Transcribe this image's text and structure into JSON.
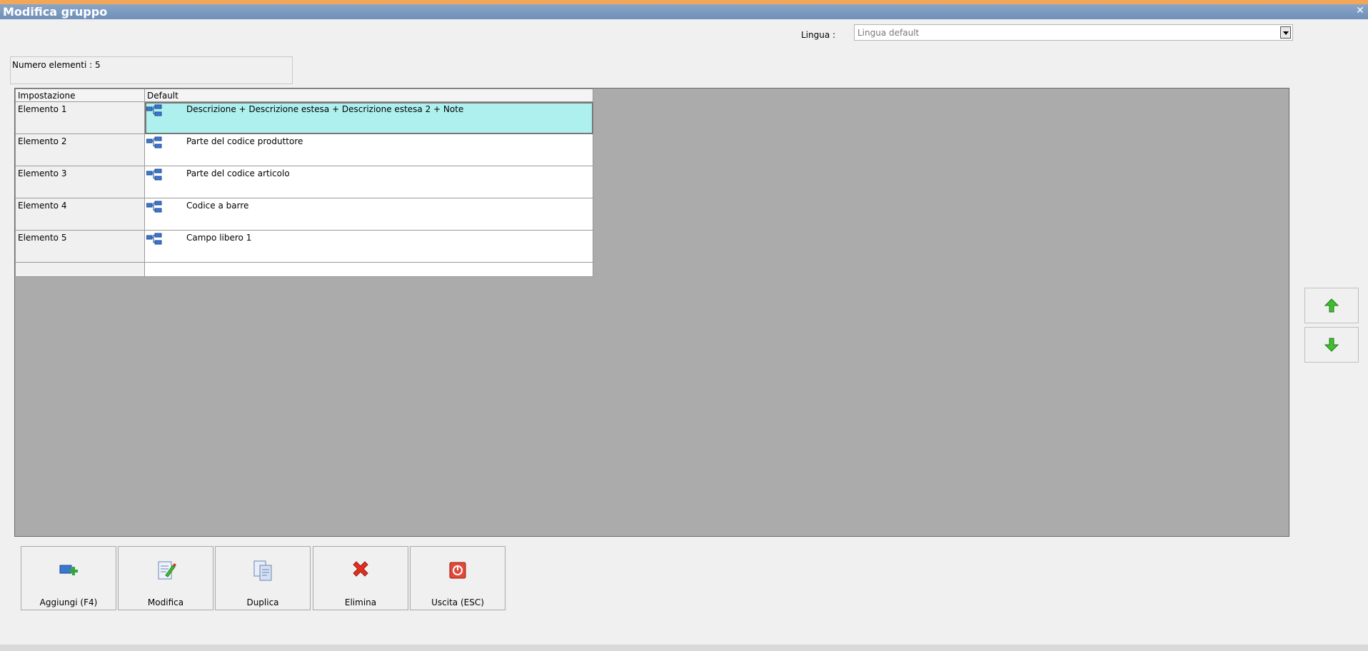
{
  "window": {
    "title": "Modifica gruppo",
    "close_icon": "close-icon"
  },
  "language": {
    "label": "Lingua :",
    "selected": "Lingua default"
  },
  "count_label": "Numero elementi : 5",
  "grid": {
    "columns": [
      "Impostazione",
      "Default"
    ],
    "rows": [
      {
        "setting": "Elemento 1",
        "value": "Descrizione + Descrizione estesa + Descrizione estesa 2 + Note",
        "icon": "tree-icon",
        "selected": true
      },
      {
        "setting": "Elemento 2",
        "value": "Parte del codice produttore",
        "icon": "tree-icon",
        "selected": false
      },
      {
        "setting": "Elemento 3",
        "value": "Parte del codice articolo",
        "icon": "tree-icon",
        "selected": false
      },
      {
        "setting": "Elemento 4",
        "value": "Codice a barre",
        "icon": "tree-icon",
        "selected": false
      },
      {
        "setting": "Elemento 5",
        "value": "Campo libero 1",
        "icon": "tree-icon",
        "selected": false
      }
    ]
  },
  "side_buttons": {
    "up_icon": "arrow-up-icon",
    "down_icon": "arrow-down-icon"
  },
  "toolbar": {
    "add_label": "Aggiungi (F4)",
    "edit_label": "Modifica",
    "duplicate_label": "Duplica",
    "delete_label": "Elimina",
    "exit_label": "Uscita (ESC)"
  },
  "colors": {
    "selected_row": "#aef0ee",
    "title_bar": "#7b98bf",
    "accent_stripe": "#f2a65a",
    "arrow_green": "#3fbf2f",
    "delete_red": "#e03020"
  }
}
